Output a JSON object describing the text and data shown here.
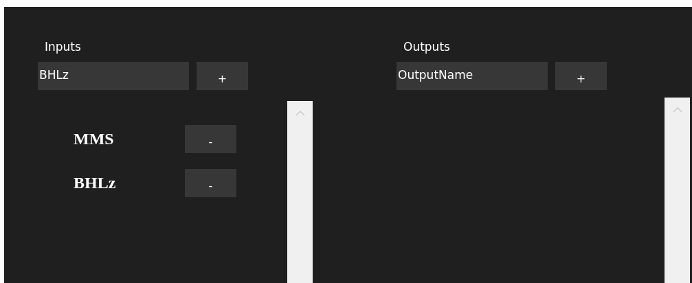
{
  "panels": [
    {
      "title": "Inputs",
      "field": {
        "value": "BHLz"
      },
      "add_button": "+",
      "items": [
        {
          "label": "MMS",
          "remove_button": "-"
        },
        {
          "label": "BHLz",
          "remove_button": "-"
        }
      ]
    },
    {
      "title": "Outputs",
      "field": {
        "value": "OutputName"
      },
      "add_button": "+"
    }
  ]
}
